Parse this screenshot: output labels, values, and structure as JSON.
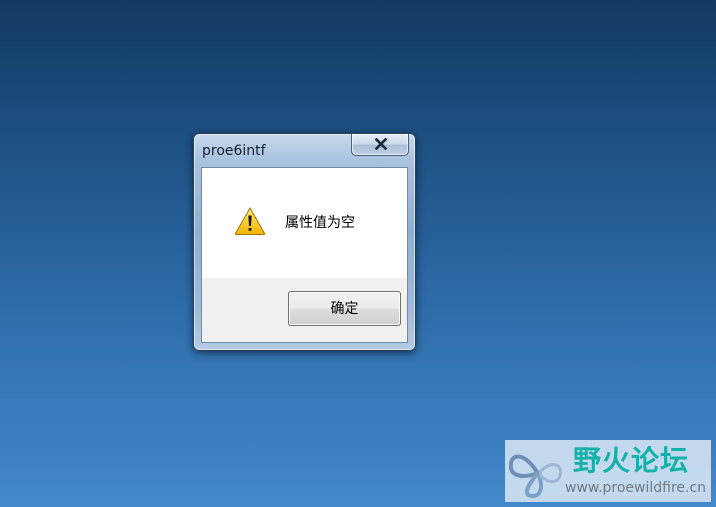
{
  "desktop": {
    "background_top": "#123a63",
    "background_bottom": "#4388cc"
  },
  "dialog": {
    "title": "proe6intf",
    "close_icon": "close-icon",
    "message_icon": "warning-icon",
    "message": "属性值为空",
    "ok_button_label": "确定"
  },
  "watermark": {
    "logo_icon": "butterfly-logo-icon",
    "title": "野火论坛",
    "url": "www.proewildfire.cn",
    "accent_color": "#14b1a8"
  }
}
